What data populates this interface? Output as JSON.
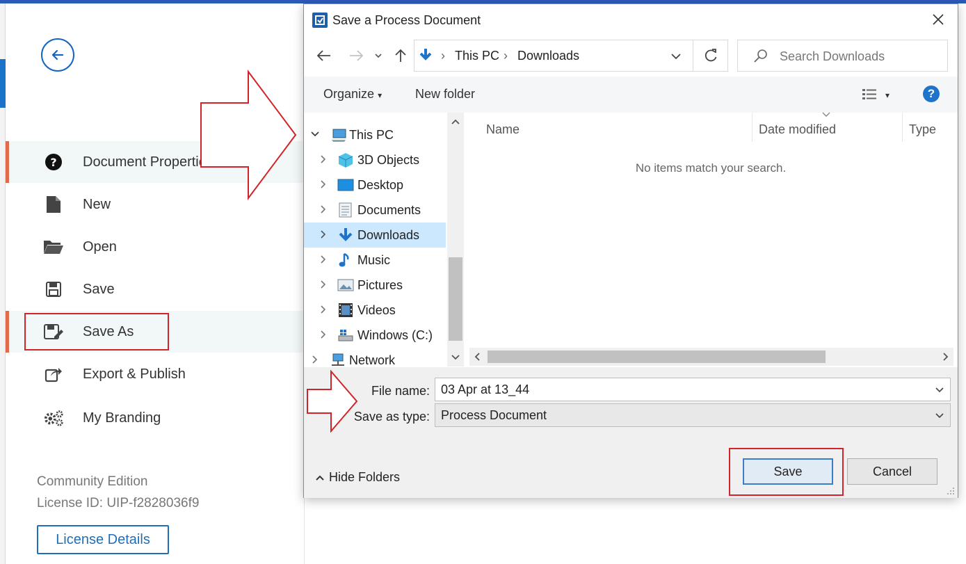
{
  "backstage": {
    "menu": [
      {
        "label": "Document Properties",
        "icon": "question-circle-icon"
      },
      {
        "label": "New",
        "icon": "file-icon"
      },
      {
        "label": "Open",
        "icon": "folder-open-icon"
      },
      {
        "label": "Save",
        "icon": "floppy-disk-icon"
      },
      {
        "label": "Save As",
        "icon": "save-as-icon"
      },
      {
        "label": "Export & Publish",
        "icon": "share-icon"
      },
      {
        "label": "My Branding",
        "icon": "gears-icon"
      }
    ],
    "edition": "Community Edition",
    "license_id": "License ID: UIP-f2828036f9",
    "license_button": "License Details"
  },
  "dialog": {
    "title": "Save a Process Document",
    "address": {
      "root": "This PC",
      "folder": "Downloads"
    },
    "search_placeholder": "Search Downloads",
    "toolbar": {
      "organize": "Organize",
      "new_folder": "New folder"
    },
    "tree": [
      {
        "label": "This PC",
        "icon": "computer-icon"
      },
      {
        "label": "3D Objects",
        "icon": "cube-icon"
      },
      {
        "label": "Desktop",
        "icon": "desktop-icon"
      },
      {
        "label": "Documents",
        "icon": "document-icon"
      },
      {
        "label": "Downloads",
        "icon": "download-arrow-icon"
      },
      {
        "label": "Music",
        "icon": "music-note-icon"
      },
      {
        "label": "Pictures",
        "icon": "picture-icon"
      },
      {
        "label": "Videos",
        "icon": "film-icon"
      },
      {
        "label": "Windows (C:)",
        "icon": "drive-icon"
      },
      {
        "label": "Network",
        "icon": "network-icon"
      }
    ],
    "columns": {
      "name": "Name",
      "date_modified": "Date modified",
      "type": "Type"
    },
    "empty_message": "No items match your search.",
    "file_name_label": "File name:",
    "file_name_value": "03 Apr at 13_44",
    "save_type_label": "Save as type:",
    "save_type_value": "Process Document",
    "hide_folders": "Hide Folders",
    "save_button": "Save",
    "cancel_button": "Cancel"
  },
  "colors": {
    "accent": "#1f6fb8",
    "annotation_red": "#d2232a",
    "selected": "#cce8ff",
    "active_marker": "#e06b4c"
  }
}
